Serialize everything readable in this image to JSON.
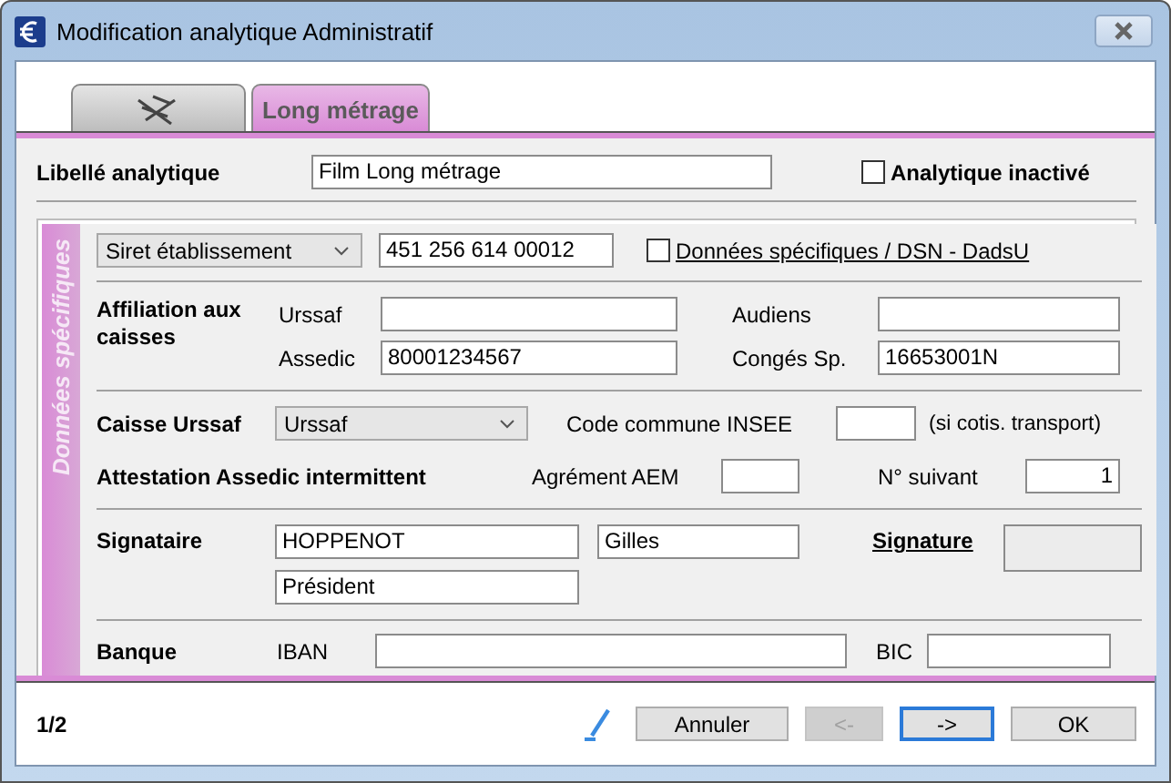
{
  "window": {
    "title": "Modification analytique Administratif"
  },
  "tabs": [
    {
      "kind": "icon",
      "selected": false
    },
    {
      "kind": "text",
      "label": "Long métrage",
      "selected": true
    }
  ],
  "libelle": {
    "label": "Libellé analytique",
    "value": "Film Long métrage"
  },
  "inactive": {
    "label": "Analytique inactivé",
    "checked": false
  },
  "section": {
    "title": "Données spécifiques",
    "siret": {
      "option": "Siret établissement",
      "value": "451 256 614 00012"
    },
    "dsn": {
      "label": "Données spécifiques / DSN - DadsU",
      "checked": false
    },
    "affiliation": {
      "label": "Affiliation aux caisses",
      "fields": [
        {
          "label": "Urssaf"
        },
        {
          "label": "Audiens"
        },
        {
          "label": "Assedic",
          "value": "80001234567"
        },
        {
          "label": "Congés Sp.",
          "value": "16653001N"
        }
      ]
    },
    "caisse": {
      "label": "Caisse Urssaf",
      "option": "Urssaf",
      "insee_label": "Code commune INSEE",
      "insee_note": "(si cotis. transport)"
    },
    "attestation": {
      "label": "Attestation Assedic intermittent",
      "aem_label": "Agrément AEM",
      "next_label": "N° suivant",
      "next_value": "1"
    },
    "signataire": {
      "label": "Signataire",
      "last_name": "HOPPENOT",
      "first_name": "Gilles",
      "role": "Président",
      "signature_label": "Signature"
    },
    "banque": {
      "label": "Banque",
      "iban_label": "IBAN",
      "bic_label": "BIC"
    }
  },
  "footer": {
    "page": "1/2",
    "buttons": [
      {
        "label": "Annuler",
        "disabled": false,
        "focused": false
      },
      {
        "label": "<-",
        "disabled": true,
        "focused": false
      },
      {
        "label": "->",
        "disabled": false,
        "focused": true
      },
      {
        "label": "OK",
        "disabled": false,
        "focused": false
      }
    ]
  }
}
